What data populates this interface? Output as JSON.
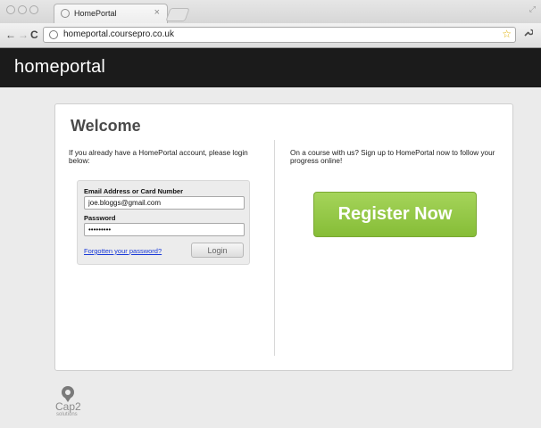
{
  "browser": {
    "tab_title": "HomePortal",
    "tab_close": "×",
    "url": "homeportal.coursepro.co.uk",
    "back_icon": "left-arrow",
    "forward_icon": "right-arrow",
    "reload_icon": "reload",
    "bookmark_icon": "star",
    "menu_icon": "wrench",
    "glyphs": {
      "back": "←",
      "forward": "→",
      "reload": "C",
      "star": "☆",
      "wrench": "🔧",
      "grip": "⤢"
    }
  },
  "header": {
    "logo_text": "homeportal"
  },
  "main": {
    "title": "Welcome",
    "login_intro": "If you already have a HomePortal account, please login below:",
    "register_intro": "On a course with us? Sign up to HomePortal now to follow your progress online!",
    "login_form": {
      "email_label": "Email Address or Card Number",
      "email_value": "joe.bloggs@gmail.com",
      "password_label": "Password",
      "password_value": "•••••••••",
      "forgot_link": "Forgotten your password?",
      "login_button": "Login"
    },
    "register_button": "Register Now"
  },
  "footer": {
    "logo_name": "Cap2",
    "logo_sub": "solutions"
  },
  "colors": {
    "header_bg": "#1b1b1b",
    "register_green": "#8fc540",
    "link_blue": "#1a3ad8"
  }
}
